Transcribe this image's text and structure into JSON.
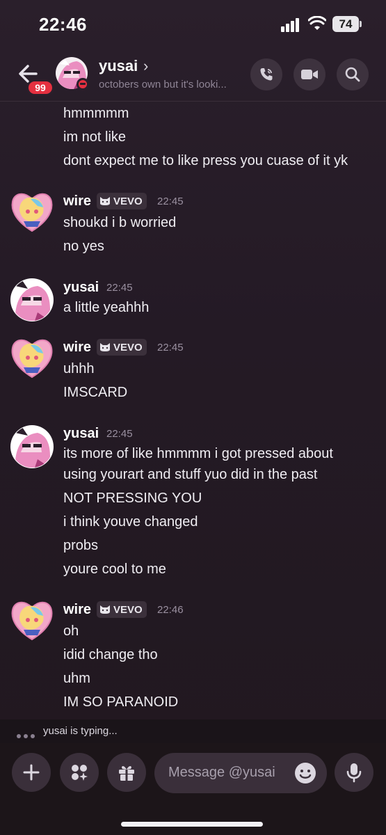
{
  "status_bar": {
    "time": "22:46",
    "battery": "74"
  },
  "header": {
    "back_badge": "99",
    "name": "yusai",
    "chevron": "›",
    "subtitle": "octobers own but it's looki...",
    "avatar_icon": "yusai-avatar-icon",
    "status": "do-not-disturb"
  },
  "messages": {
    "continued": [
      "hmmmmm",
      "im not like",
      "dont expect me to like press you cuase of it yk"
    ],
    "groups": [
      {
        "author": "wire",
        "tag": "VEVO",
        "time": "22:45",
        "lines": [
          "shoukd i b worried",
          "no yes"
        ]
      },
      {
        "author": "yusai",
        "time": "22:45",
        "lines": [
          "a little yeahhh"
        ]
      },
      {
        "author": "wire",
        "tag": "VEVO",
        "time": "22:45",
        "lines": [
          "uhhh",
          "IMSCARD"
        ]
      },
      {
        "author": "yusai",
        "time": "22:45",
        "lines": [
          "its more of like hmmmm i got pressed about",
          "using yourart and stuff yuo did in the past",
          "NOT PRESSING YOU",
          "i think youve changed",
          "probs",
          "youre cool to me"
        ]
      },
      {
        "author": "wire",
        "tag": "VEVO",
        "time": "22:46",
        "lines": [
          "oh",
          "idid change tho",
          "uhm",
          "IM SO PARANOID"
        ]
      }
    ]
  },
  "typing": {
    "text": "yusai is typing..."
  },
  "composer": {
    "placeholder": "Message @yusai"
  },
  "colors": {
    "background": "#241a25",
    "dnd_red": "#e53040",
    "badge_red": "#e53040",
    "button_bg": "#3a2f3a"
  }
}
